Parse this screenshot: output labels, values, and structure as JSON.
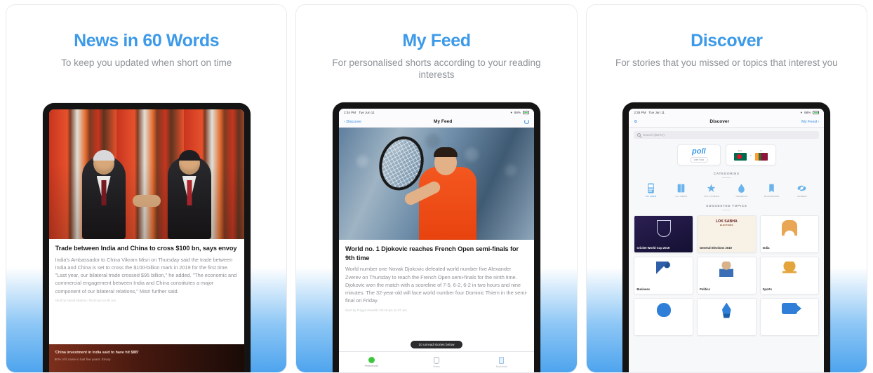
{
  "panels": [
    {
      "title": "News in 60 Words",
      "subtitle": "To keep you updated when short on time",
      "article": {
        "headline": "Trade between India and China to cross $100 bn, says envoy",
        "body": "India's Ambassador to China Vikram Misri on Thursday said the trade between India and China is set to cross the $100-billion mark in 2019 for the first time. \"Last year, our bilateral trade crossed $95 billion,\" he added. \"The economic and commercial engagement between India and China constitutes a major component of our bilateral relations,\" Misri further said.",
        "credit": "short by Anmol Sharma / 05:42 pm on 06 Jun"
      },
      "banner": {
        "headline": "'China investment in India said to have hit $8B'",
        "subtext": "80% of it came in last five years: Envoy"
      }
    },
    {
      "title": "My Feed",
      "subtitle": "For personalised shorts according to your reading interests",
      "statusbar": {
        "time": "2:34 PM",
        "date": "Tue Jun 11",
        "wifi": "wifi-icon",
        "battery": "88%"
      },
      "navbar": {
        "back": "Discover",
        "title": "My Feed",
        "action": "refresh-icon"
      },
      "article": {
        "headline": "World no. 1 Djokovic reaches French Open semi-finals for 9th time",
        "body": "World number one Novak Djokovic defeated world number five Alexander Zverev on Thursday to reach the French Open semi-finals for the ninth time. Djokovic won the match with a scoreline of 7-5, 6-2, 6-2 in two hours and nine minutes. The 32-year-old will face world number four Dominic Thiem in the semi-final on Friday.",
        "credit": "short by Pragya Swastik / 02:18 pm on 07 Jun"
      },
      "pill": "10 unread stories below",
      "tabs": [
        {
          "label": "Preferences",
          "icon": "green-dot-icon"
        },
        {
          "label": "Share",
          "icon": "share-icon"
        },
        {
          "label": "Bookmark",
          "icon": "bookmark-icon"
        }
      ]
    },
    {
      "title": "Discover",
      "subtitle": "For stories that you missed or topics that interest you",
      "statusbar": {
        "time": "2:35 PM",
        "date": "Tue Jun 11",
        "wifi": "wifi-icon",
        "battery": "88%"
      },
      "navbar": {
        "left": "settings-icon",
        "title": "Discover",
        "right": "My Feed"
      },
      "search": {
        "placeholder": "Search (BETA)",
        "icon": "search-icon"
      },
      "widgets": {
        "poll": {
          "word": "poll",
          "button": "Vote Now"
        },
        "match": {
          "team_a": "BAN",
          "team_b": "SL",
          "vs": "v"
        }
      },
      "categories_title": "CATEGORIES",
      "categories": [
        {
          "label": "MY FEED",
          "icon": "feed-icon",
          "selected": true
        },
        {
          "label": "ALL NEWS",
          "icon": "news-icon",
          "selected": false
        },
        {
          "label": "TOP STORIES",
          "icon": "star-icon",
          "selected": false
        },
        {
          "label": "TRENDING",
          "icon": "flame-icon",
          "selected": false
        },
        {
          "label": "BOOKMARKS",
          "icon": "bookmark-icon",
          "selected": false
        },
        {
          "label": "UNREAD",
          "icon": "unread-icon",
          "selected": false
        }
      ],
      "topics_title": "SUGGESTED TOPICS",
      "topics": [
        {
          "label": "Cricket World Cup 2019",
          "style": "dark",
          "art": "trophy-icon"
        },
        {
          "label": "General Elections 2019",
          "style": "cream",
          "art": "lok-sabha-icon",
          "overline": "LOK SABHA",
          "overline_sub": "ELECTIONS"
        },
        {
          "label": "India",
          "style": "plain",
          "art": "india-gate-icon"
        },
        {
          "label": "Business",
          "style": "plain",
          "art": "runner-icon"
        },
        {
          "label": "Politics",
          "style": "plain",
          "art": "politician-icon"
        },
        {
          "label": "Sports",
          "style": "plain",
          "art": "cup-icon"
        },
        {
          "label": "",
          "style": "plain",
          "art": "brain-icon"
        },
        {
          "label": "",
          "style": "plain",
          "art": "rocket-icon"
        },
        {
          "label": "",
          "style": "plain",
          "art": "camera-icon"
        }
      ]
    }
  ],
  "colors": {
    "accent": "#3d9ae8",
    "subtitle": "#8e9399",
    "wash": "#4ea4ee"
  }
}
